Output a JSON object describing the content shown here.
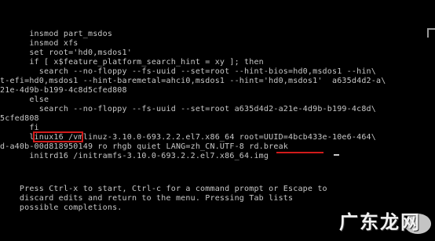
{
  "editor": {
    "lines": [
      "      insmod part_msdos",
      "      insmod xfs",
      "      set root='hd0,msdos1'",
      "      if [ x$feature_platform_search_hint = xy ]; then",
      "        search --no-floppy --fs-uuid --set=root --hint-bios=hd0,msdos1 --hin\\",
      "t-efi=hd0,msdos1 --hint-baremetal=ahci0,msdos1 --hint='hd0,msdos1'  a635d4d2-a\\",
      "21e-4d9b-b199-4c8d5cfed808",
      "      else",
      "        search --no-floppy --fs-uuid --set=root a635d4d2-a21e-4d9b-b199-4c8d\\",
      "5cfed808",
      "      fi",
      "      linux16 /vmlinuz-3.10.0-693.2.2.el7.x86_64 root=UUID=4bcb433e-10e6-464\\",
      "d-a40b-00d818950149 ro rhgb quiet LANG=zh_CN.UTF-8 rd.break",
      "      initrd16 /initramfs-3.10.0-693.2.2.el7.x86_64.img"
    ],
    "help": [
      "    Press Ctrl-x to start, Ctrl-c for a command prompt or Escape to",
      "    discard edits and return to the menu. Pressing Tab lists",
      "    possible completions."
    ]
  },
  "watermark": {
    "brand": "广东龙网"
  }
}
